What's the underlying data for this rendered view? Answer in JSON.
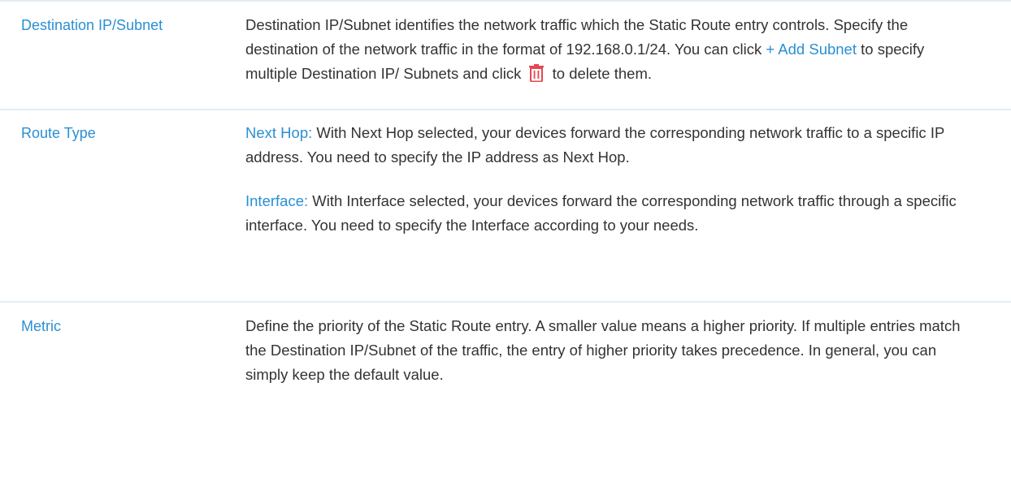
{
  "rows": [
    {
      "term": "Destination IP/Subnet",
      "desc": {
        "t1": "Destination IP/Subnet identifies the network traffic which the Static Route entry controls. Specify the destination of the network traffic in the format of 192.168.0.1/24.  You can click ",
        "link": "+ Add Subnet",
        "t2": " to specify multiple Destination IP/ Subnets and click ",
        "icon": "trash-icon",
        "t3": " to delete them."
      }
    },
    {
      "term": "Route Type",
      "p1_label": "Next Hop:",
      "p1_text": " With Next Hop selected, your devices forward the corresponding network traffic to a specific IP address. You need to specify the IP address as Next Hop.",
      "p2_label": "Interface:",
      "p2_text": " With Interface selected, your devices forward the corresponding network traffic through a specific interface. You need to specify the Interface according to your needs."
    },
    {
      "term": "Metric",
      "desc": "Define the priority of the Static Route entry. A smaller value means a higher priority. If multiple entries match the Destination IP/Subnet of the traffic, the entry of higher priority takes precedence. In general, you can simply keep the default value."
    }
  ],
  "colors": {
    "accent": "#2a8fd4",
    "text": "#333333",
    "rule": "#e3ecf3",
    "trash_icon": "#e8474f"
  }
}
